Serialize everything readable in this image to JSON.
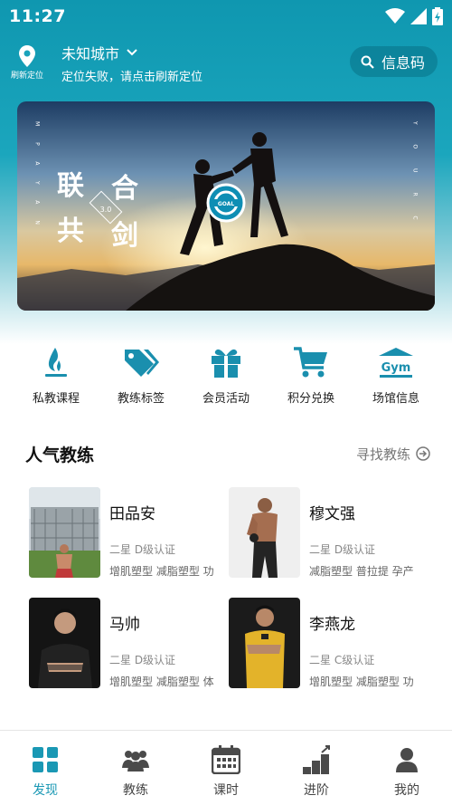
{
  "status_bar": {
    "time": "11:27"
  },
  "header": {
    "refresh_label": "刷新定位",
    "city": "未知城市",
    "location_error": "定位失败，请点击刷新定位",
    "info_code_label": "信息码"
  },
  "banner": {
    "title_chars": [
      "联",
      "合",
      "共",
      "剑"
    ],
    "version": "3.0",
    "logo_text": "GOAL",
    "side_left": "MPAYAN",
    "side_right": "YOURC"
  },
  "quick_menu": [
    {
      "label": "私教课程",
      "icon": "flame-icon"
    },
    {
      "label": "教练标签",
      "icon": "tags-icon"
    },
    {
      "label": "会员活动",
      "icon": "gift-icon"
    },
    {
      "label": "积分兑换",
      "icon": "cart-icon"
    },
    {
      "label": "场馆信息",
      "icon": "gym-icon",
      "icon_text": "Gym"
    }
  ],
  "popular": {
    "title": "人气教练",
    "find_label": "寻找教练"
  },
  "coaches": [
    {
      "name": "田品安",
      "level": "二星  D级认证",
      "tags": "增肌塑型 减脂塑型 功"
    },
    {
      "name": "穆文强",
      "level": "二星  D级认证",
      "tags": "减脂塑型 普拉提 孕产"
    },
    {
      "name": "马帅",
      "level": "二星  D级认证",
      "tags": "增肌塑型 减脂塑型 体"
    },
    {
      "name": "李燕龙",
      "level": "二星  C级认证",
      "tags": "增肌塑型 减脂塑型 功"
    }
  ],
  "bottom_nav": [
    {
      "label": "发现",
      "icon": "grid-icon",
      "active": true
    },
    {
      "label": "教练",
      "icon": "group-icon"
    },
    {
      "label": "课时",
      "icon": "calendar-icon"
    },
    {
      "label": "进阶",
      "icon": "podium-icon"
    },
    {
      "label": "我的",
      "icon": "user-icon"
    }
  ],
  "colors": {
    "accent": "#1a98b4",
    "header_bg": "#1aa3bb",
    "icon_teal": "#1a8fae"
  }
}
